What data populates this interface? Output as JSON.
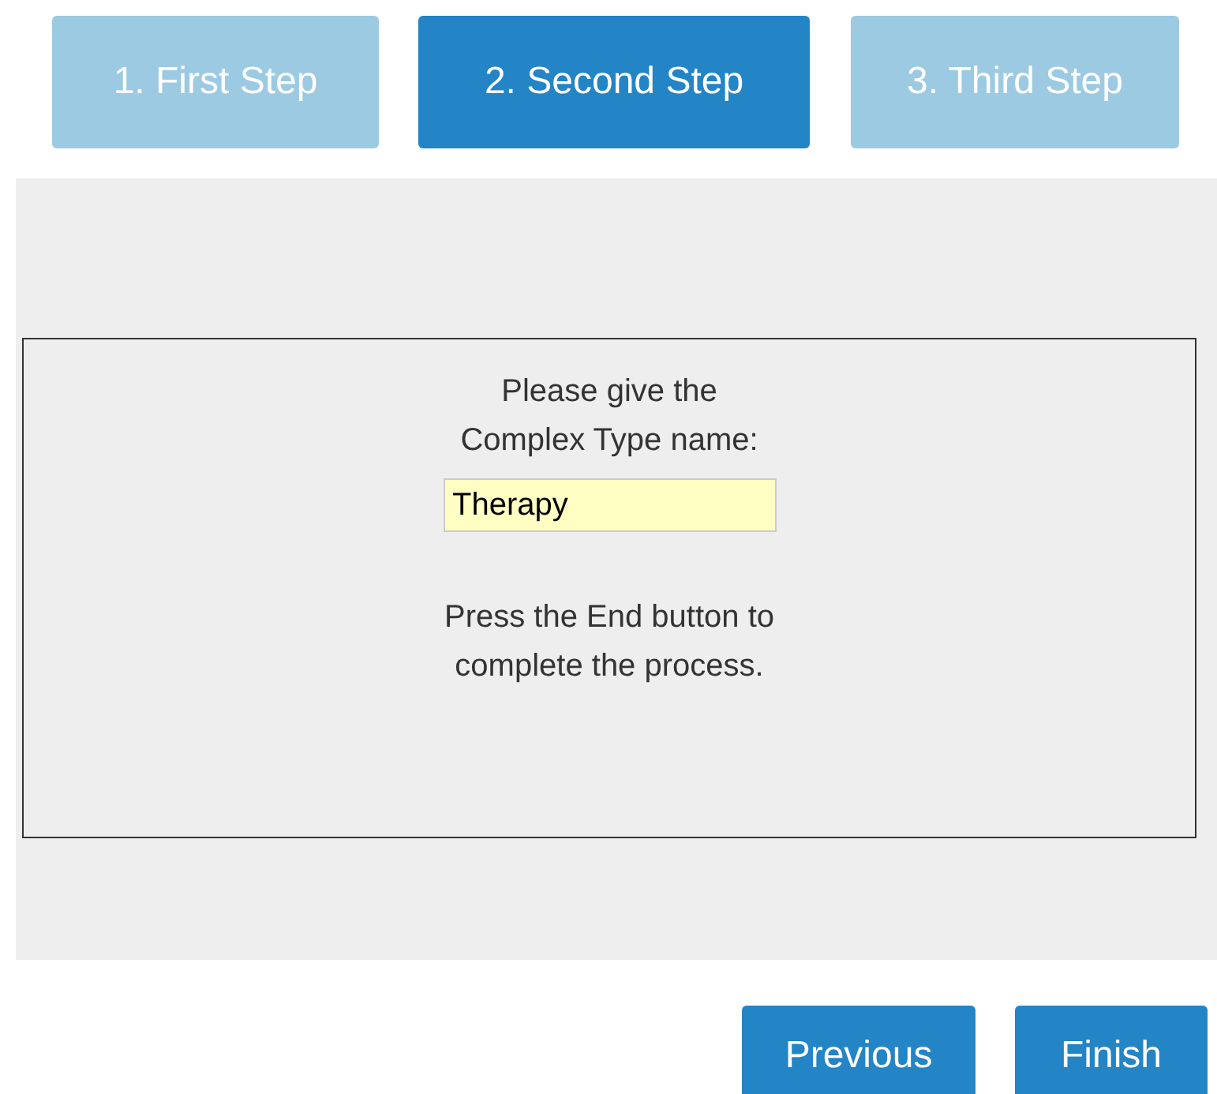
{
  "steps": [
    {
      "label": "1. First Step",
      "selected": false
    },
    {
      "label": "2. Second Step",
      "selected": true
    },
    {
      "label": "3. Third Step",
      "selected": false
    }
  ],
  "prompt": "Please give the Complex Type name:",
  "name_field": {
    "value": "Therapy"
  },
  "note": "Press the End button to complete the process.",
  "buttons": [
    "Previous",
    "Finish"
  ]
}
